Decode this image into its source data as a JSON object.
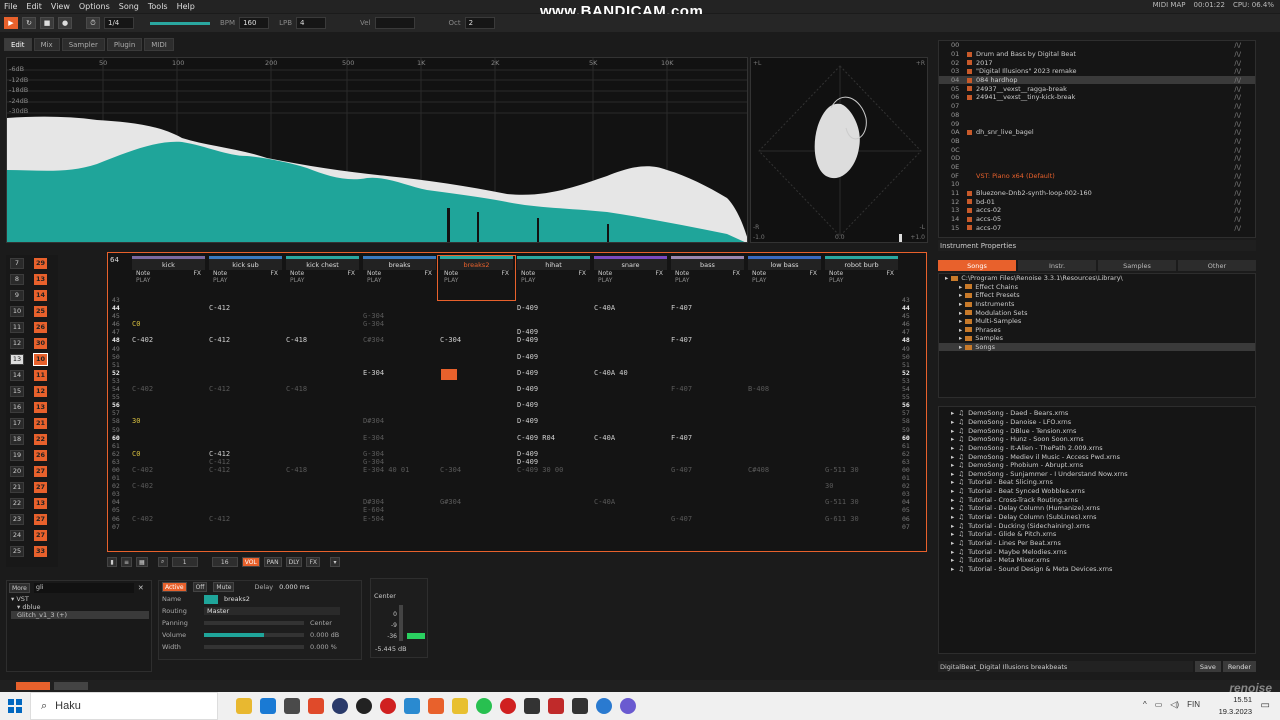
{
  "menu": [
    "File",
    "Edit",
    "View",
    "Options",
    "Song",
    "Tools",
    "Help"
  ],
  "watermark": "www.BANDICAM.com",
  "sysinfo": {
    "mode": "MIDI MAP",
    "time": "00:01:22",
    "cpu": "CPU: 06.4%"
  },
  "transport": {
    "pattern": "1/4",
    "bpm_label": "BPM",
    "bpm": "160",
    "lpb_label": "LPB",
    "lpb": "4",
    "vel_label": "Vel",
    "oct_label": "Oct",
    "oct": "2"
  },
  "tabs": [
    "Edit",
    "Mix",
    "Sampler",
    "Plugin",
    "MIDI"
  ],
  "spectrum": {
    "db": [
      "-6dB",
      "-12dB",
      "-18dB",
      "-24dB",
      "-30dB"
    ],
    "freqs": [
      "50",
      "100",
      "200",
      "500",
      "1K",
      "2K",
      "5K",
      "10K"
    ],
    "footer_left": "-1.0",
    "footer_mid": "0.0",
    "footer_right": "+1.0",
    "scope_tl": "+L",
    "scope_tr": "+R",
    "scope_bl": "-R",
    "scope_br": "-L"
  },
  "songs": [
    {
      "n": "00",
      "name": ""
    },
    {
      "n": "01",
      "name": "Drum and Bass by Digital Beat"
    },
    {
      "n": "02",
      "name": "2017"
    },
    {
      "n": "03",
      "name": "\"Digital Illusions\" 2023 remake"
    },
    {
      "n": "04",
      "name": "084 hardhop",
      "sel": true
    },
    {
      "n": "05",
      "name": "24937__vexst__ragga-break"
    },
    {
      "n": "06",
      "name": "24941__vexst__tiny-kick-break"
    },
    {
      "n": "07",
      "name": ""
    },
    {
      "n": "08",
      "name": ""
    },
    {
      "n": "09",
      "name": ""
    },
    {
      "n": "0A",
      "name": "dh_snr_live_bagel"
    },
    {
      "n": "0B",
      "name": ""
    },
    {
      "n": "0C",
      "name": ""
    },
    {
      "n": "0D",
      "name": ""
    },
    {
      "n": "0E",
      "name": ""
    },
    {
      "n": "0F",
      "name": "VST: Piano x64 (Default)",
      "vst": true
    },
    {
      "n": "10",
      "name": ""
    },
    {
      "n": "11",
      "name": "Bluezone-Dnb2-synth-loop-002-160"
    },
    {
      "n": "12",
      "name": "bd-01"
    },
    {
      "n": "13",
      "name": "accs-02"
    },
    {
      "n": "14",
      "name": "accs-05"
    },
    {
      "n": "15",
      "name": "accs-07"
    }
  ],
  "instrument_properties": "Instrument Properties",
  "browser_tabs": [
    "Songs",
    "Instr.",
    "Samples",
    "Other"
  ],
  "browser_tree": [
    {
      "name": "C:\\Program Files\\Renoise 3.3.1\\Resources\\Library\\",
      "root": true
    },
    {
      "name": "Effect Chains"
    },
    {
      "name": "Effect Presets"
    },
    {
      "name": "Instruments"
    },
    {
      "name": "Modulation Sets"
    },
    {
      "name": "Multi-Samples"
    },
    {
      "name": "Phrases"
    },
    {
      "name": "Samples"
    },
    {
      "name": "Songs",
      "sel": true
    }
  ],
  "files": [
    "DemoSong - Daed - Bears.xrns",
    "DemoSong - Danoise - LFO.xrns",
    "DemoSong - DBlue - Tension.xrns",
    "DemoSong - Hunz - Soon Soon.xrns",
    "DemoSong - It-Alien - ThePath 2.009.xrns",
    "DemoSong - Mediev il Music - Access Pwd.xrns",
    "DemoSong - Phobium - Abrupt.xrns",
    "DemoSong - Sunjammer - I Understand Now.xrns",
    "Tutorial - Beat Slicing.xrns",
    "Tutorial - Beat Synced Wobbles.xrns",
    "Tutorial - Cross-Track Routing.xrns",
    "Tutorial - Delay Column (Humanize).xrns",
    "Tutorial - Delay Column (SubLines).xrns",
    "Tutorial - Ducking (Sidechaining).xrns",
    "Tutorial - Glide & Pitch.xrns",
    "Tutorial - Lines Per Beat.xrns",
    "Tutorial - Maybe Melodies.xrns",
    "Tutorial - Meta Mixer.xrns",
    "Tutorial - Sound Design & Meta Devices.xrns"
  ],
  "save_path": "DigitalBeat_Digital Illusions breakbeats",
  "save_btn": "Save",
  "render_btn": "Render",
  "sequencer": [
    {
      "n": "7",
      "p": "29"
    },
    {
      "n": "8",
      "p": "13"
    },
    {
      "n": "9",
      "p": "14"
    },
    {
      "n": "10",
      "p": "25"
    },
    {
      "n": "11",
      "p": "26"
    },
    {
      "n": "12",
      "p": "30"
    },
    {
      "n": "13",
      "p": "10",
      "cur": true
    },
    {
      "n": "14",
      "p": "11"
    },
    {
      "n": "15",
      "p": "12"
    },
    {
      "n": "16",
      "p": "13"
    },
    {
      "n": "17",
      "p": "21"
    },
    {
      "n": "18",
      "p": "22"
    },
    {
      "n": "19",
      "p": "26"
    },
    {
      "n": "20",
      "p": "27"
    },
    {
      "n": "21",
      "p": "27"
    },
    {
      "n": "22",
      "p": "13"
    },
    {
      "n": "23",
      "p": "27"
    },
    {
      "n": "24",
      "p": "27"
    },
    {
      "n": "25",
      "p": "33"
    }
  ],
  "pattern_len": "64",
  "tracks": [
    {
      "name": "kick",
      "color": "#7a6aa0"
    },
    {
      "name": "kick sub",
      "color": "#3a7abf"
    },
    {
      "name": "kick chest",
      "color": "#2aa7a0"
    },
    {
      "name": "breaks",
      "color": "#3a7abf"
    },
    {
      "name": "breaks2",
      "color": "#2aa7a0",
      "active": true
    },
    {
      "name": "hihat",
      "color": "#2aa7a0"
    },
    {
      "name": "snare",
      "color": "#7a4ac0"
    },
    {
      "name": "bass",
      "color": "#9a88b0"
    },
    {
      "name": "low bass",
      "color": "#3a6abf"
    },
    {
      "name": "robot burb",
      "color": "#2aa7a0"
    }
  ],
  "track_sub": {
    "note": "Note",
    "fx": "FX",
    "play": "PLAY"
  },
  "rows": [
    {
      "r": "43",
      "c": []
    },
    {
      "r": "44",
      "hl": true,
      "c": [
        [
          1,
          "C-412"
        ],
        [
          5,
          "D-409"
        ],
        [
          6,
          "C-40A"
        ],
        [
          7,
          "F-407"
        ]
      ]
    },
    {
      "r": "45",
      "c": [
        [
          3,
          "G-304",
          "dim"
        ]
      ]
    },
    {
      "r": "46",
      "c": [
        [
          0,
          "C0",
          "yel"
        ],
        [
          3,
          "G-304",
          "dim"
        ]
      ]
    },
    {
      "r": "47",
      "c": [
        [
          5,
          "D-409"
        ]
      ]
    },
    {
      "r": "48",
      "hl": true,
      "c": [
        [
          0,
          "C-402"
        ],
        [
          1,
          "C-412"
        ],
        [
          2,
          "C-418"
        ],
        [
          3,
          "C#304",
          "dim"
        ],
        [
          4,
          "C-304"
        ],
        [
          5,
          "D-409"
        ],
        [
          7,
          "F-407"
        ]
      ]
    },
    {
      "r": "49",
      "c": []
    },
    {
      "r": "50",
      "c": [
        [
          5,
          "D-409"
        ]
      ]
    },
    {
      "r": "51",
      "c": []
    },
    {
      "r": "52",
      "hl": true,
      "c": [
        [
          3,
          "E-304"
        ],
        [
          5,
          "D-409"
        ],
        [
          6,
          "C-40A 40"
        ]
      ]
    },
    {
      "r": "53",
      "c": []
    },
    {
      "r": "54",
      "c": [
        [
          0,
          "C-402",
          "dim"
        ],
        [
          1,
          "C-412",
          "dim"
        ],
        [
          2,
          "C-418",
          "dim"
        ],
        [
          5,
          "D-409"
        ],
        [
          7,
          "F-407",
          "dim"
        ],
        [
          8,
          "B-408",
          "dim"
        ]
      ]
    },
    {
      "r": "55",
      "c": []
    },
    {
      "r": "56",
      "hl": true,
      "c": [
        [
          5,
          "D-409"
        ]
      ]
    },
    {
      "r": "57",
      "c": []
    },
    {
      "r": "58",
      "c": [
        [
          0,
          "30",
          "yel"
        ],
        [
          3,
          "D#304",
          "dim"
        ],
        [
          5,
          "D-409"
        ]
      ]
    },
    {
      "r": "59",
      "c": []
    },
    {
      "r": "60",
      "hl": true,
      "c": [
        [
          3,
          "E-304",
          "dim"
        ],
        [
          5,
          "C-409   R04"
        ],
        [
          6,
          "C-40A"
        ],
        [
          7,
          "F-407"
        ]
      ]
    },
    {
      "r": "61",
      "c": []
    },
    {
      "r": "62",
      "c": [
        [
          0,
          "C0",
          "yel"
        ],
        [
          1,
          "C-412"
        ],
        [
          3,
          "G-304",
          "dim"
        ],
        [
          5,
          "D-409"
        ]
      ]
    },
    {
      "r": "63",
      "c": [
        [
          1,
          "C-412",
          "dim"
        ],
        [
          3,
          "G-304",
          "dim"
        ],
        [
          5,
          "D-409"
        ]
      ]
    },
    {
      "r": "00",
      "c": [
        [
          0,
          "C-402",
          "dim"
        ],
        [
          1,
          "C-412",
          "dim"
        ],
        [
          2,
          "C-418",
          "dim"
        ],
        [
          3,
          "E-304  40 01",
          "dim"
        ],
        [
          4,
          "C-304",
          "dim"
        ],
        [
          5,
          "C-409   30 00",
          "dim"
        ],
        [
          7,
          "G-407",
          "dim"
        ],
        [
          8,
          "C#408",
          "dim"
        ],
        [
          9,
          "G-511  30",
          "dim"
        ]
      ]
    },
    {
      "r": "01",
      "c": []
    },
    {
      "r": "02",
      "c": [
        [
          0,
          "C-402",
          "dim"
        ],
        [
          9,
          "30",
          "dim"
        ]
      ]
    },
    {
      "r": "03",
      "c": []
    },
    {
      "r": "04",
      "c": [
        [
          3,
          "D#304",
          "dim"
        ],
        [
          4,
          "G#304",
          "dim"
        ],
        [
          6,
          "C-40A",
          "dim"
        ],
        [
          9,
          "G-511  30",
          "dim"
        ]
      ]
    },
    {
      "r": "05",
      "c": [
        [
          3,
          "E-604",
          "dim"
        ]
      ]
    },
    {
      "r": "06",
      "c": [
        [
          0,
          "C-402",
          "dim"
        ],
        [
          1,
          "C-412",
          "dim"
        ],
        [
          3,
          "E-504",
          "dim"
        ],
        [
          7,
          "G-407",
          "dim"
        ],
        [
          9,
          "G-611  30",
          "dim"
        ]
      ]
    },
    {
      "r": "07",
      "c": []
    }
  ],
  "pattern_toolbar": {
    "step": "1",
    "edit_step": "16"
  },
  "dsp": {
    "label": "More",
    "filter": "gli",
    "vst": "VST",
    "dblue": "dblue",
    "plugin": "Glitch_v1_3 (+)"
  },
  "mixer": {
    "active": "Active",
    "off": "Off",
    "mute": "Mute",
    "delay": "Delay",
    "delay_val": "0.000 ms",
    "name_label": "Name",
    "name": "breaks2",
    "routing_label": "Routing",
    "routing": "Master",
    "panning_label": "Panning",
    "panning": "Center",
    "volume_label": "Volume",
    "volume": "0.000 dB",
    "width_label": "Width",
    "width": "0.000 %"
  },
  "level": {
    "label": "Center",
    "db0": "0",
    "db1": "-9",
    "db2": "-36",
    "val": "-5.445 dB"
  },
  "taskbar": {
    "search": "Haku",
    "lang": "FIN",
    "time": "15.51",
    "date": "19.3.2023"
  },
  "brand": "renoise",
  "colors": {
    "accent": "#e8612c",
    "teal": "#1fa59a"
  }
}
